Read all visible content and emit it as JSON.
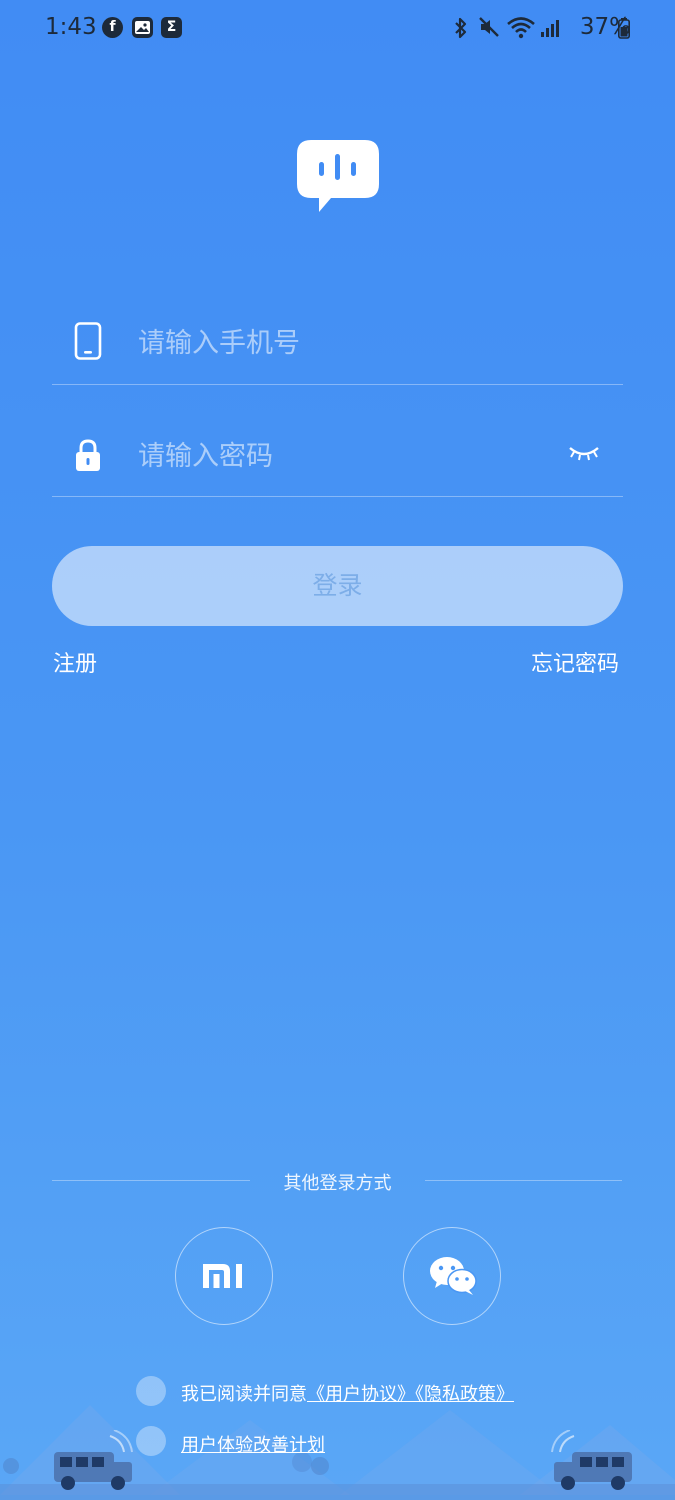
{
  "status_bar": {
    "time": "1:43",
    "battery": "37%"
  },
  "login": {
    "phone_placeholder": "请输入手机号",
    "password_placeholder": "请输入密码",
    "login_button": "登录",
    "register_link": "注册",
    "forgot_password_link": "忘记密码"
  },
  "other_login": {
    "label": "其他登录方式"
  },
  "agreement": {
    "prefix": "我已阅读并同意",
    "user_agreement": "《用户协议》",
    "privacy_policy": "《隐私政策》",
    "experience_plan": "用户体验改善计划"
  },
  "colors": {
    "background_top": "#418cf4",
    "background_bottom": "#5aa7f6",
    "status_text": "#1d2a3a"
  }
}
